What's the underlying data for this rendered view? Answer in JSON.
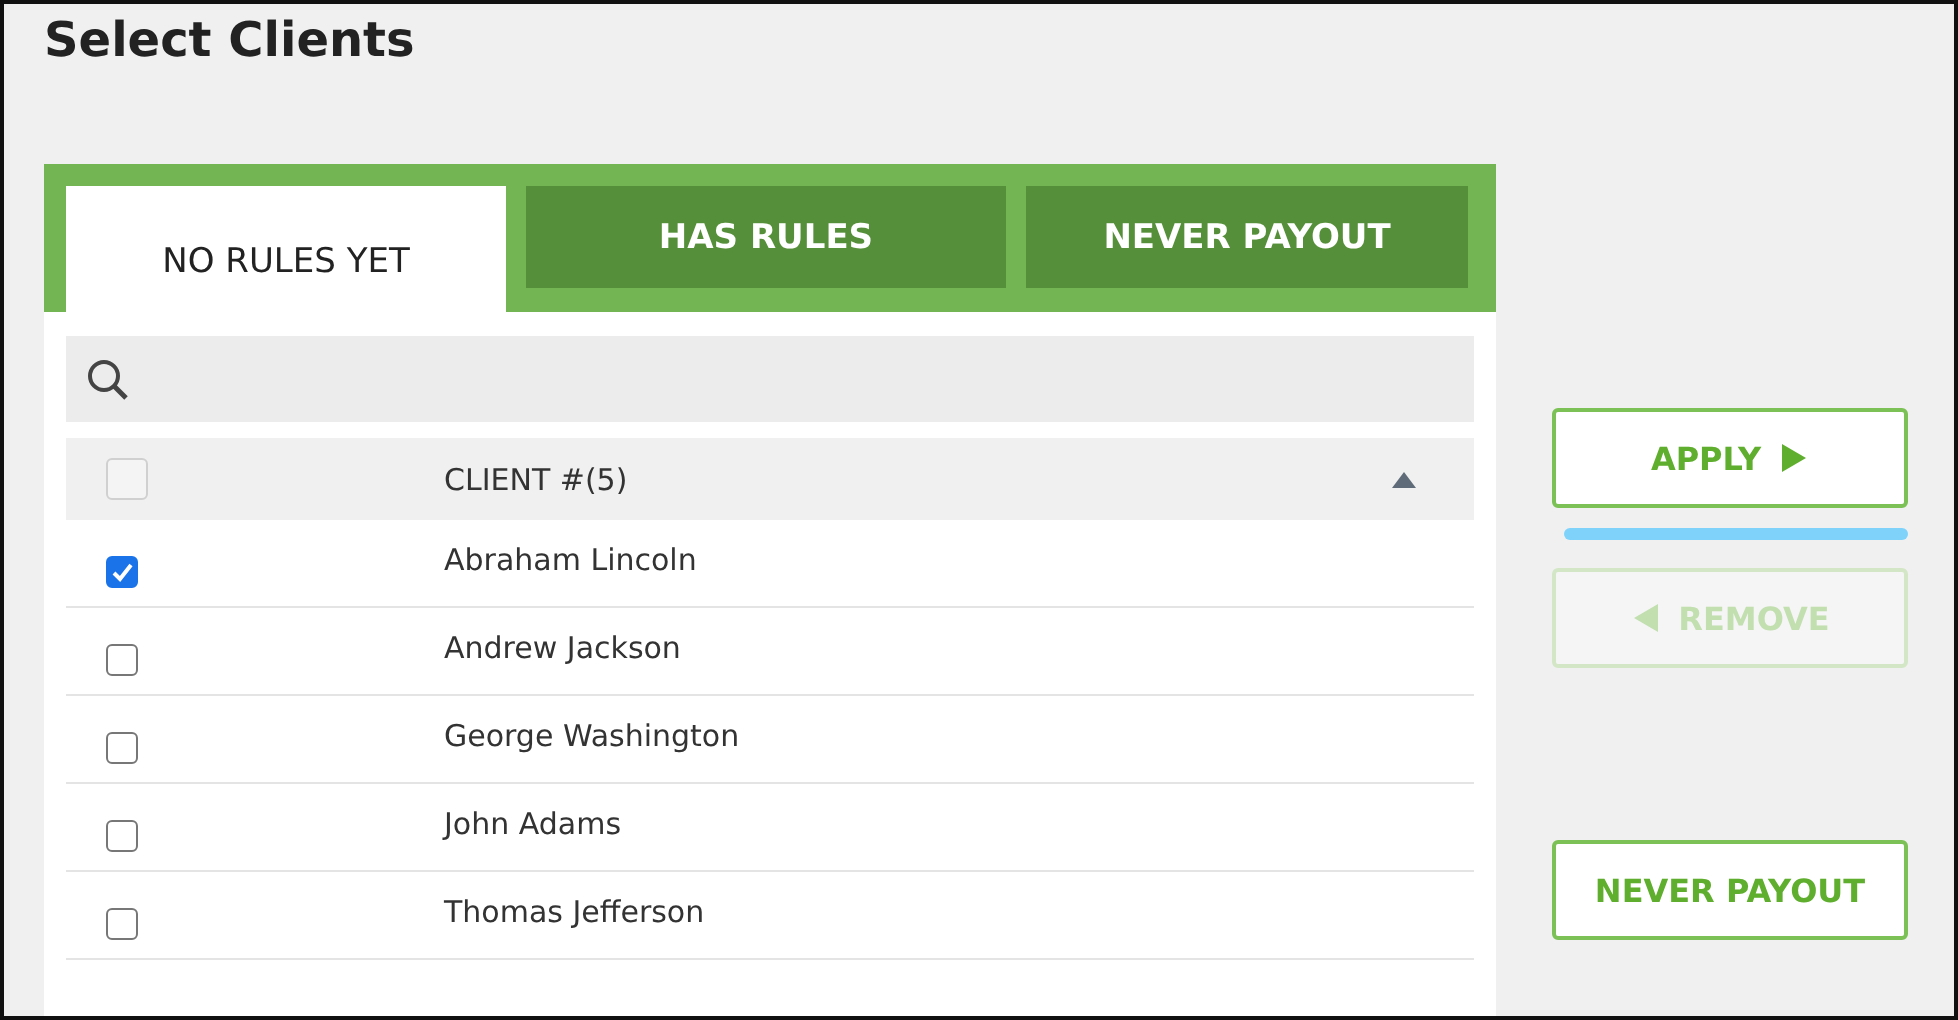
{
  "title": "Select Clients",
  "tabs": [
    {
      "label": "NO RULES YET",
      "selected": true
    },
    {
      "label": "HAS RULES",
      "selected": false
    },
    {
      "label": "NEVER PAYOUT",
      "selected": false
    }
  ],
  "search": {
    "focused": false
  },
  "table": {
    "select_all": {
      "checked": false
    },
    "columns": [
      {
        "label": "CLIENT #(5)",
        "sorted_ascending": true
      }
    ],
    "rows": [
      {
        "name": "Abraham Lincoln",
        "checked": true
      },
      {
        "name": "Andrew Jackson",
        "checked": false
      },
      {
        "name": "George Washington",
        "checked": false
      },
      {
        "name": "John Adams",
        "checked": false
      },
      {
        "name": "Thomas Jefferson",
        "checked": false
      }
    ]
  },
  "actions": [
    {
      "label": "APPLY",
      "kind": "apply",
      "disabled": false
    },
    {
      "kind": "progress",
      "level": 1
    },
    {
      "label": "REMOVE",
      "kind": "remove",
      "disabled": true
    },
    {
      "kind": "spacer"
    },
    {
      "label": "NEVER PAYOUT",
      "kind": "plain",
      "disabled": false
    }
  ]
}
